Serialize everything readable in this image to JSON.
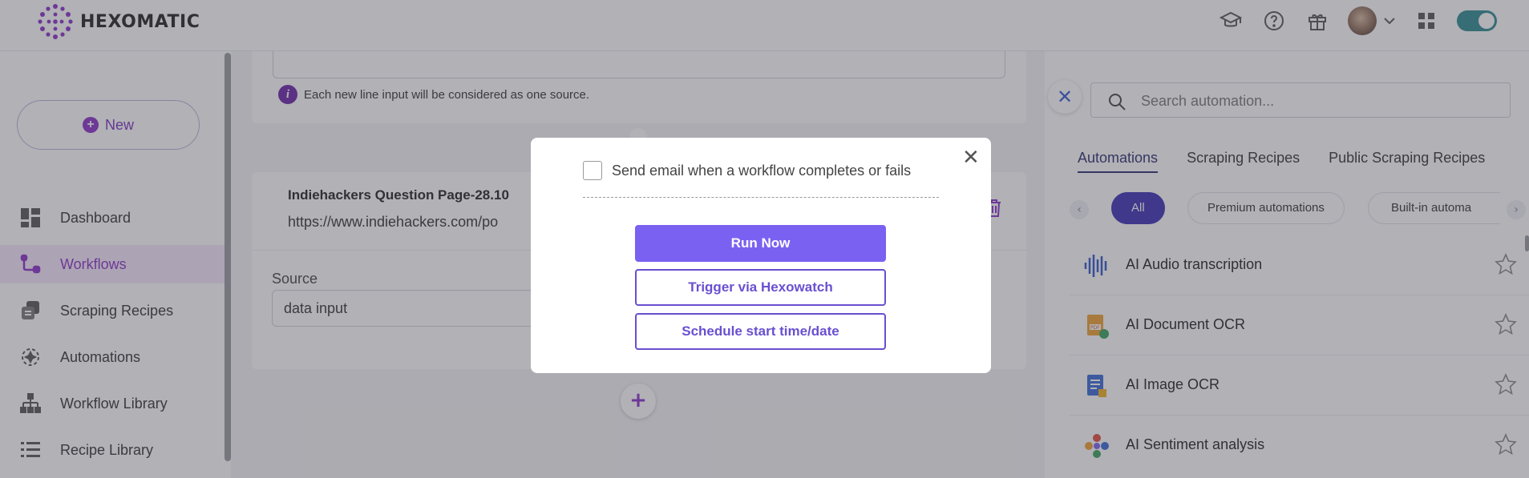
{
  "header": {
    "logo_text": "HEXOMATIC",
    "icons": [
      "graduation-cap-icon",
      "help-circle-icon",
      "gift-icon",
      "avatar",
      "chevron-down-icon",
      "apps-grid-icon",
      "theme-toggle"
    ]
  },
  "sidebar": {
    "new_label": "New",
    "items": [
      {
        "label": "Dashboard",
        "icon": "dashboard-icon",
        "active": false
      },
      {
        "label": "Workflows",
        "icon": "workflows-icon",
        "active": true
      },
      {
        "label": "Scraping Recipes",
        "icon": "scraping-recipes-icon",
        "active": false
      },
      {
        "label": "Automations",
        "icon": "automations-icon",
        "active": false
      },
      {
        "label": "Workflow Library",
        "icon": "workflow-library-icon",
        "active": false
      },
      {
        "label": "Recipe Library",
        "icon": "recipe-library-icon",
        "active": false
      }
    ]
  },
  "main": {
    "info_text": "Each new line input will be considered as one source.",
    "step_title": "Indiehackers Question Page-28.10",
    "step_url": "https://www.indiehackers.com/po",
    "source_label": "Source",
    "source_value": "data input"
  },
  "right_panel": {
    "search_placeholder": "Search automation...",
    "tabs": [
      {
        "label": "Automations",
        "active": true
      },
      {
        "label": "Scraping Recipes",
        "active": false
      },
      {
        "label": "Public Scraping Recipes",
        "active": false
      }
    ],
    "chips": [
      {
        "label": "All",
        "active": true
      },
      {
        "label": "Premium automations",
        "active": false
      },
      {
        "label": "Built-in automa",
        "active": false
      }
    ],
    "automations": [
      {
        "name": "AI Audio transcription",
        "icon": "audio-wave-icon"
      },
      {
        "name": "AI Document OCR",
        "icon": "document-ocr-icon"
      },
      {
        "name": "AI Image OCR",
        "icon": "image-ocr-icon"
      },
      {
        "name": "AI Sentiment analysis",
        "icon": "sentiment-icon"
      }
    ]
  },
  "modal": {
    "checkbox_label": "Send email when a workflow completes or fails",
    "run_now": "Run Now",
    "trigger_hexowatch": "Trigger via Hexowatch",
    "schedule": "Schedule start time/date"
  },
  "colors": {
    "brand_purple": "#8a2fc8",
    "primary_button": "#7b61f2",
    "chip_active": "#3b2fb5",
    "toggle": "#2e8a8f"
  }
}
